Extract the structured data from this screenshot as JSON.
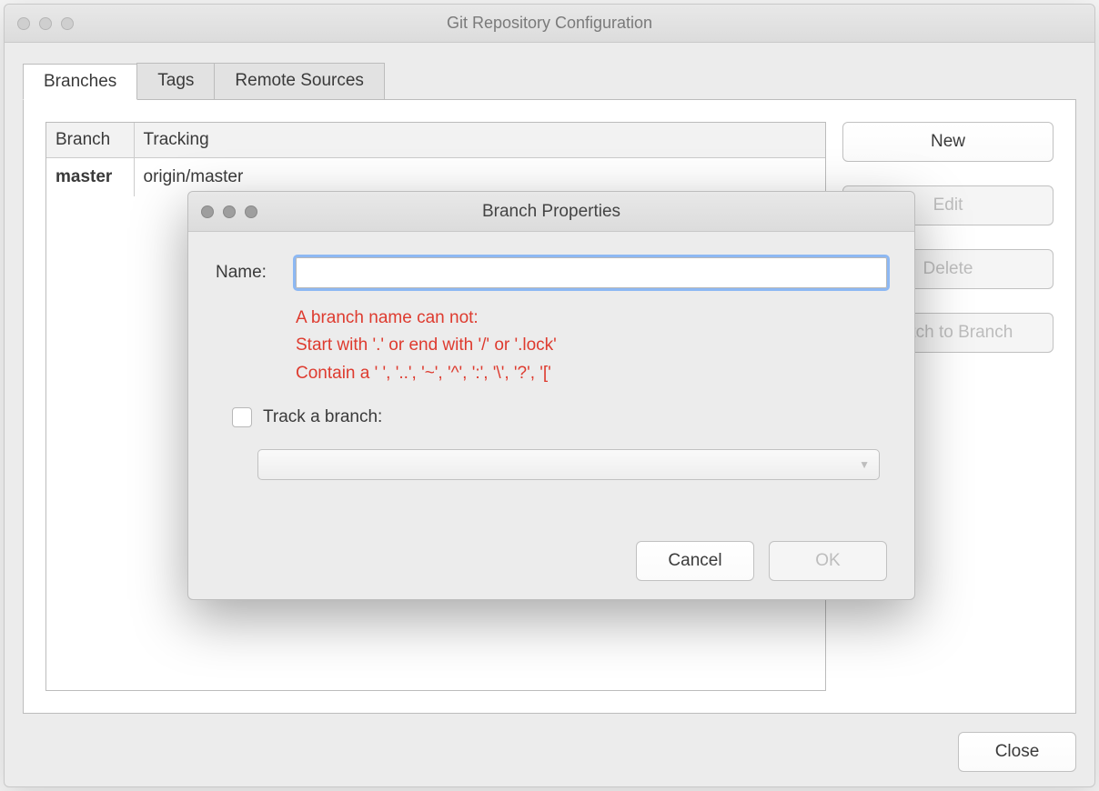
{
  "parent": {
    "title": "Git Repository Configuration",
    "tabs": {
      "branches": "Branches",
      "tags": "Tags",
      "remotes": "Remote Sources"
    },
    "columns": {
      "branch": "Branch",
      "tracking": "Tracking"
    },
    "rows": [
      {
        "branch": "master",
        "tracking": "origin/master"
      }
    ],
    "buttons": {
      "new": "New",
      "edit": "Edit",
      "delete": "Delete",
      "switch": "Switch to Branch",
      "close": "Close"
    }
  },
  "modal": {
    "title": "Branch Properties",
    "name_label": "Name:",
    "name_value": "",
    "validation": {
      "l1": "A branch name can not:",
      "l2": "Start with '.' or end with '/' or '.lock'",
      "l3": "Contain a ' ', '..', '~', '^', ':', '\\', '?', '['"
    },
    "track_label": "Track a branch:",
    "cancel": "Cancel",
    "ok": "OK"
  }
}
